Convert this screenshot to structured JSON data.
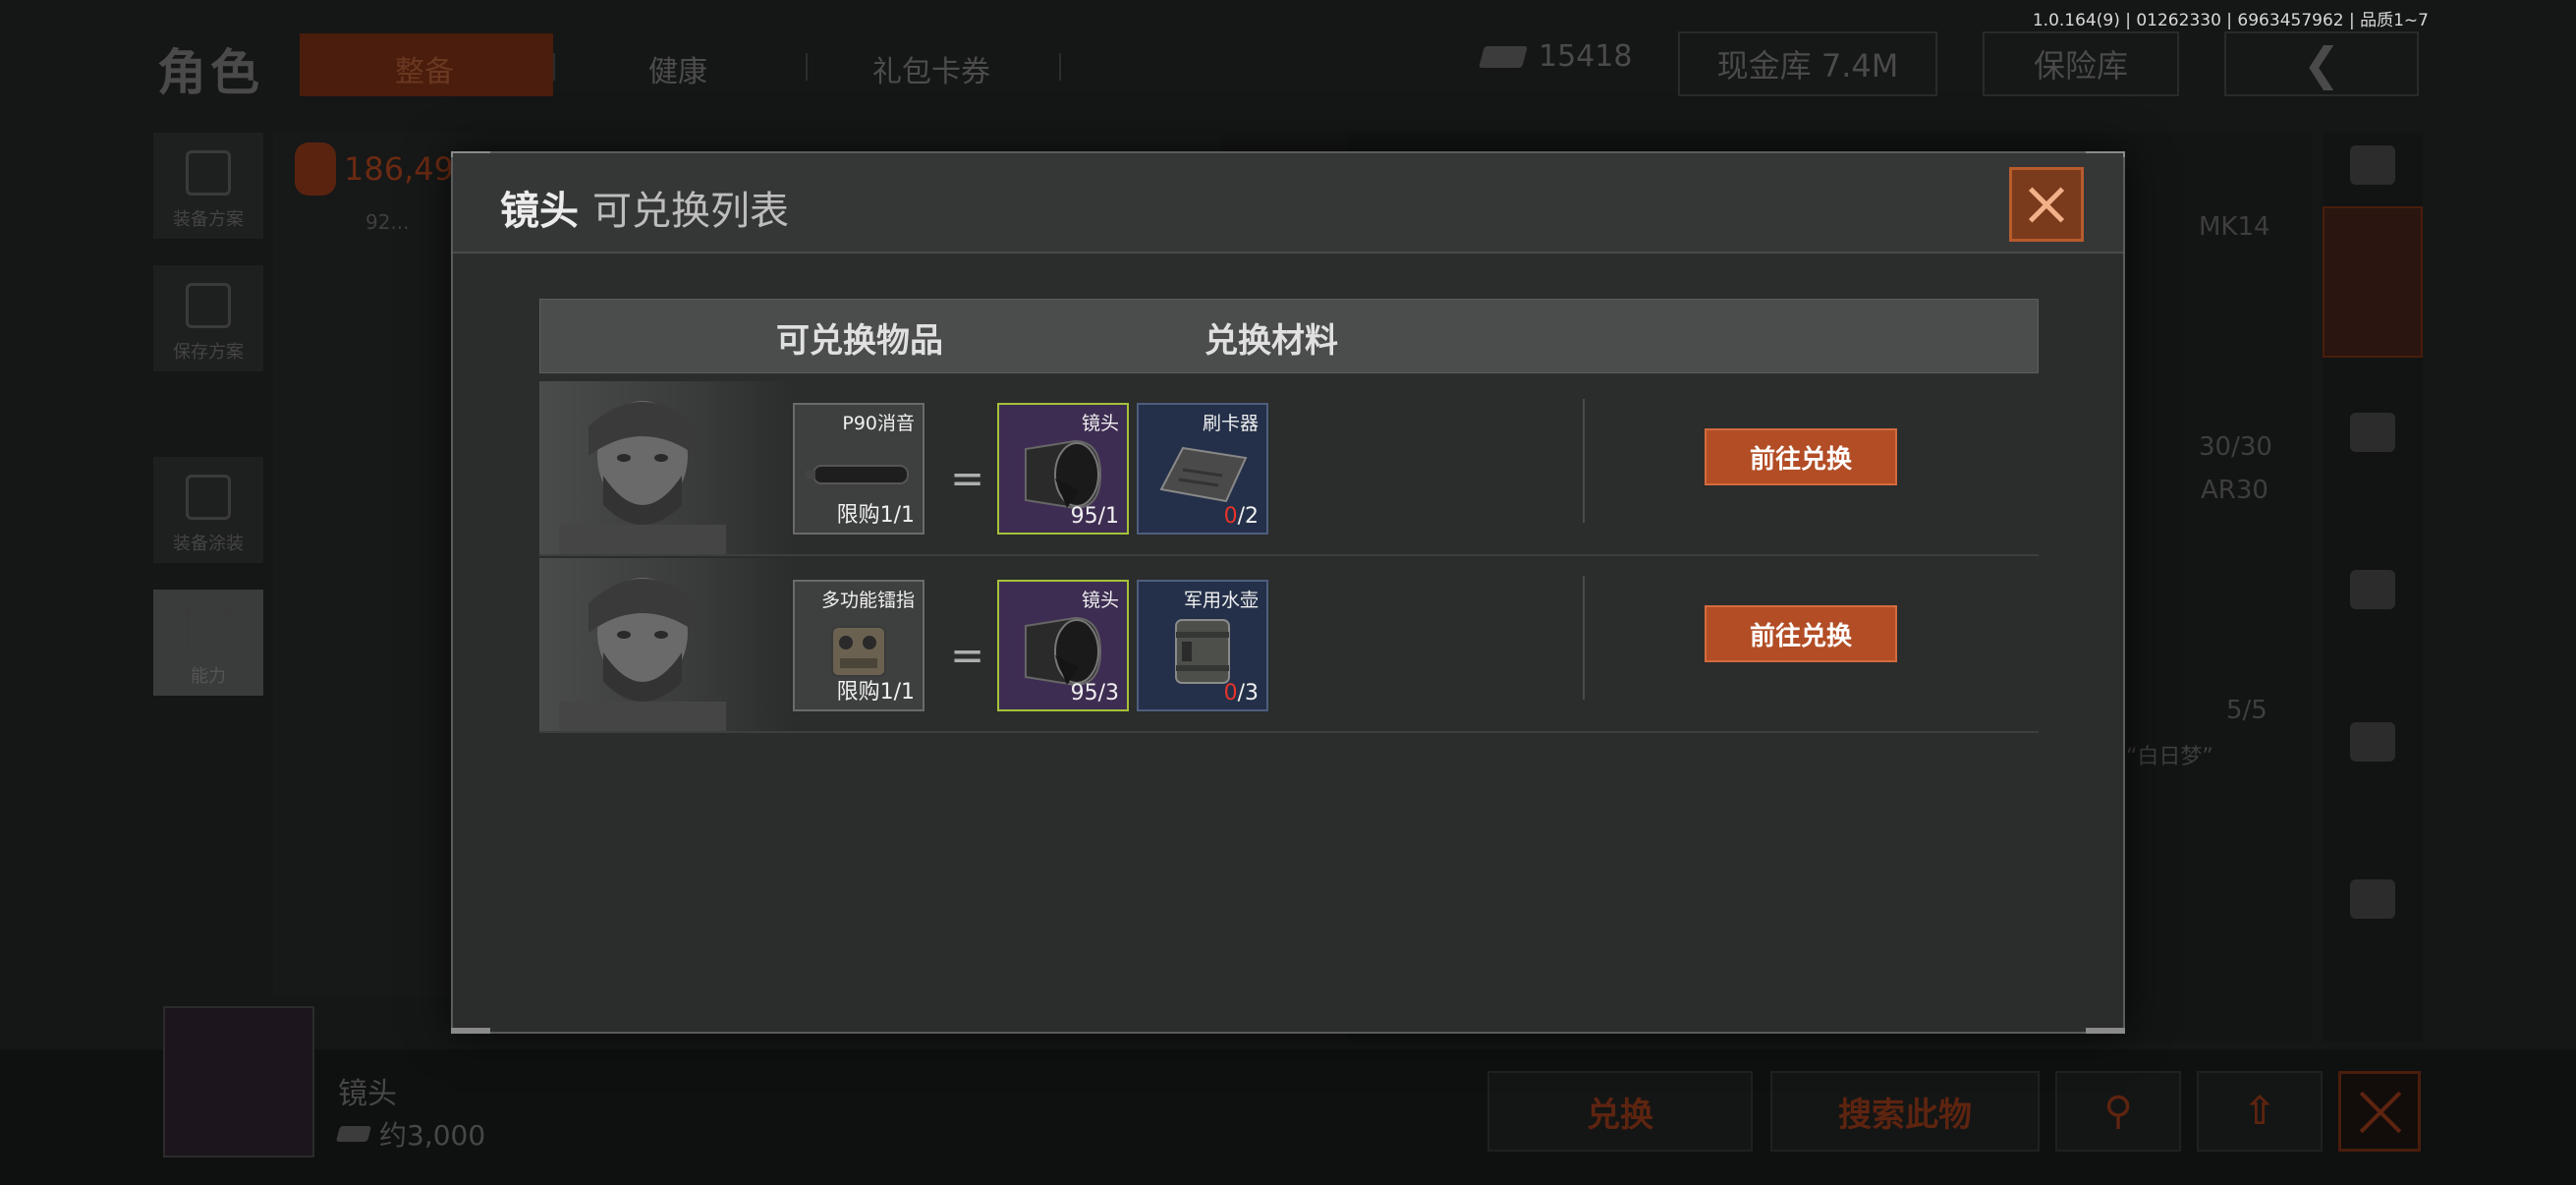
{
  "build_info": "1.0.164(9) | 01262330 | 6963457962 | 品质1~7",
  "background": {
    "title": "角色",
    "tabs": [
      "整备",
      "健康",
      "礼包卡券"
    ],
    "money": "15418",
    "cash_vault": "现金库 7.4M",
    "safe": "保险库",
    "side_buttons": [
      "装备方案",
      "保存方案",
      "装备涂装",
      "能力"
    ],
    "value_text": "186,49",
    "small_label": "92...",
    "weapons": [
      {
        "name": "MK14",
        "ammo": "30/30"
      },
      {
        "name": "AR30",
        "ammo": "5/5"
      }
    ],
    "quote": "“白日梦”",
    "selected_item": {
      "name": "镜头",
      "price": "约3,000"
    },
    "bottom_buttons": {
      "exchange": "兑换",
      "search": "搜索此物"
    }
  },
  "modal": {
    "title_item": "镜头",
    "title_rest": "可兑换列表",
    "col_exchangeable": "可兑换物品",
    "col_materials": "兑换材料",
    "rows": [
      {
        "target": {
          "name": "P90消音",
          "limit": "限购1/1",
          "icon": "suppressor-icon"
        },
        "materials": [
          {
            "name": "镜头",
            "have": "95",
            "need": "/1",
            "rarity": "purple",
            "icon": "lens-icon"
          },
          {
            "name": "刷卡器",
            "have": "0",
            "need": "/2",
            "rarity": "blue",
            "icon": "card-reader-icon"
          }
        ],
        "button": "前往兑换"
      },
      {
        "target": {
          "name": "多功能镭指",
          "limit": "限购1/1",
          "icon": "laser-sight-icon"
        },
        "materials": [
          {
            "name": "镜头",
            "have": "95",
            "need": "/3",
            "rarity": "purple",
            "icon": "lens-icon"
          },
          {
            "name": "军用水壶",
            "have": "0",
            "need": "/3",
            "rarity": "blue",
            "icon": "canteen-icon"
          }
        ],
        "button": "前往兑换"
      }
    ],
    "equals": "="
  },
  "colors": {
    "accent": "#b24d25",
    "purple": "#3e2d52",
    "blue": "#243049",
    "warning_red": "#e8332a"
  }
}
